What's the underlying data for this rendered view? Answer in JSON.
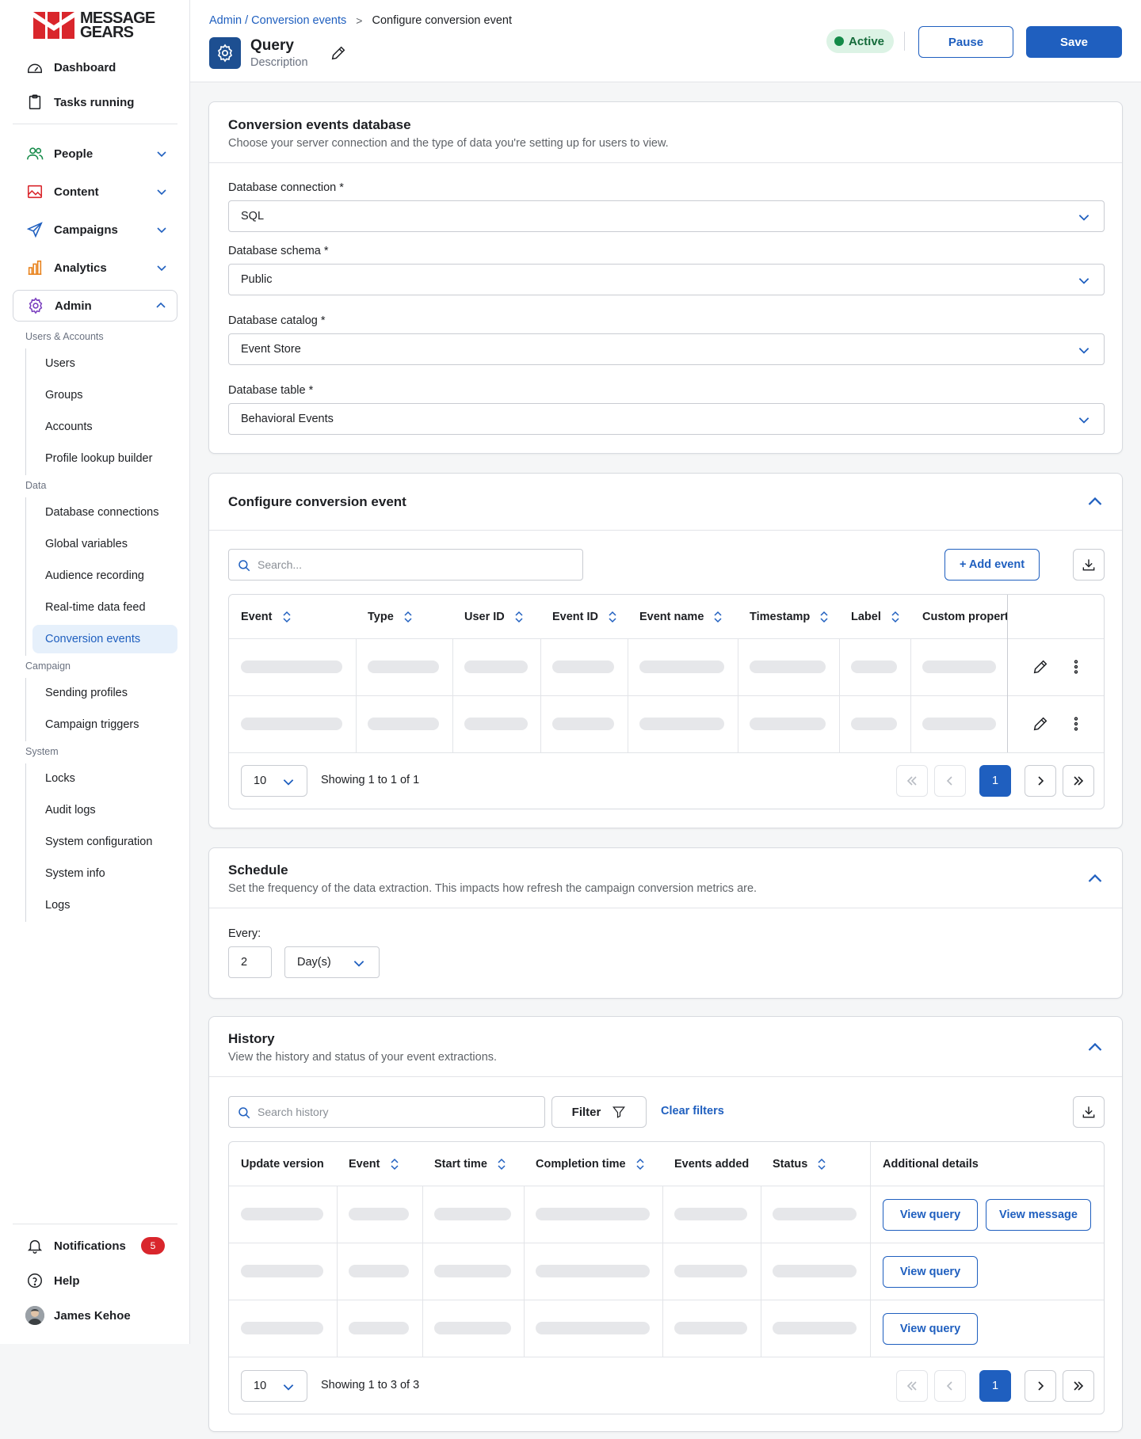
{
  "brand": {
    "line1": "MESSAGE",
    "line2": "GEARS",
    "colors": {
      "red": "#d9262c",
      "primary": "#1f5fbf",
      "active_bg": "#e6f0fb",
      "success": "#138a48"
    }
  },
  "sidebar": {
    "top_items": [
      {
        "label": "Dashboard",
        "icon": "dashboard-icon"
      },
      {
        "label": "Tasks running",
        "icon": "clipboard-icon"
      }
    ],
    "sections": [
      {
        "label": "People",
        "icon": "people-icon",
        "color": "#138a48"
      },
      {
        "label": "Content",
        "icon": "image-icon",
        "color": "#d9262c"
      },
      {
        "label": "Campaigns",
        "icon": "send-icon",
        "color": "#1f5fbf"
      },
      {
        "label": "Analytics",
        "icon": "bar-chart-icon",
        "color": "#e8811a"
      },
      {
        "label": "Admin",
        "icon": "gear-icon",
        "color": "#7b3fbf"
      }
    ],
    "admin_groups": {
      "users_accounts": {
        "label": "Users & Accounts",
        "items": [
          "Users",
          "Groups",
          "Accounts",
          "Profile lookup builder"
        ]
      },
      "data": {
        "label": "Data",
        "items": [
          "Database connections",
          "Global variables",
          "Audience recording",
          "Real-time data feed",
          "Conversion events"
        ]
      },
      "campaign": {
        "label": "Campaign",
        "items": [
          "Sending profiles",
          "Campaign triggers"
        ]
      },
      "system": {
        "label": "System",
        "items": [
          "Locks",
          "Audit logs",
          "System configuration",
          "System info",
          "Logs"
        ]
      }
    },
    "bottom": {
      "notifications": "Notifications",
      "notification_count": "5",
      "help": "Help",
      "user": "James Kehoe"
    }
  },
  "header": {
    "breadcrumb_link": "Admin / Conversion events",
    "breadcrumb_sep": ">",
    "breadcrumb_current": "Configure conversion event",
    "title": "Query",
    "description": "Description",
    "status": "Active",
    "pause_label": "Pause",
    "save_label": "Save"
  },
  "database_card": {
    "title": "Conversion events database",
    "subtitle": "Choose your server connection and the type of data you're setting up for users to view.",
    "fields": [
      {
        "label": "Database connection",
        "required": "*",
        "value": "SQL"
      },
      {
        "label": "Database schema",
        "required": "*",
        "value": "Public"
      },
      {
        "label": "Database catalog",
        "required": "*",
        "value": "Event Store"
      },
      {
        "label": "Database table",
        "required": "*",
        "value": "Behavioral Events"
      }
    ]
  },
  "configure_card": {
    "title": "Configure conversion event",
    "search_placeholder": "Search...",
    "add_event_label": "+ Add event",
    "columns": [
      "Event",
      "Type",
      "User ID",
      "Event ID",
      "Event name",
      "Timestamp",
      "Label",
      "Custom propert"
    ],
    "page_size": "10",
    "showing": "Showing 1 to 1 of 1",
    "current_page": "1"
  },
  "schedule_card": {
    "title": "Schedule",
    "subtitle": "Set the frequency of the data extraction. This impacts how refresh the campaign conversion metrics are.",
    "every_label": "Every:",
    "every_value": "2",
    "unit": "Day(s)"
  },
  "history_card": {
    "title": "History",
    "subtitle": "View the history and status of your event extractions.",
    "search_placeholder": "Search history",
    "filter_label": "Filter",
    "clear_filters_label": "Clear filters",
    "columns": [
      "Update version",
      "Event",
      "Start time",
      "Completion time",
      "Events added",
      "Status",
      "Additional details"
    ],
    "view_query_label": "View query",
    "view_message_label": "View message",
    "page_size": "10",
    "showing": "Showing 1 to 3 of 3",
    "current_page": "1"
  }
}
